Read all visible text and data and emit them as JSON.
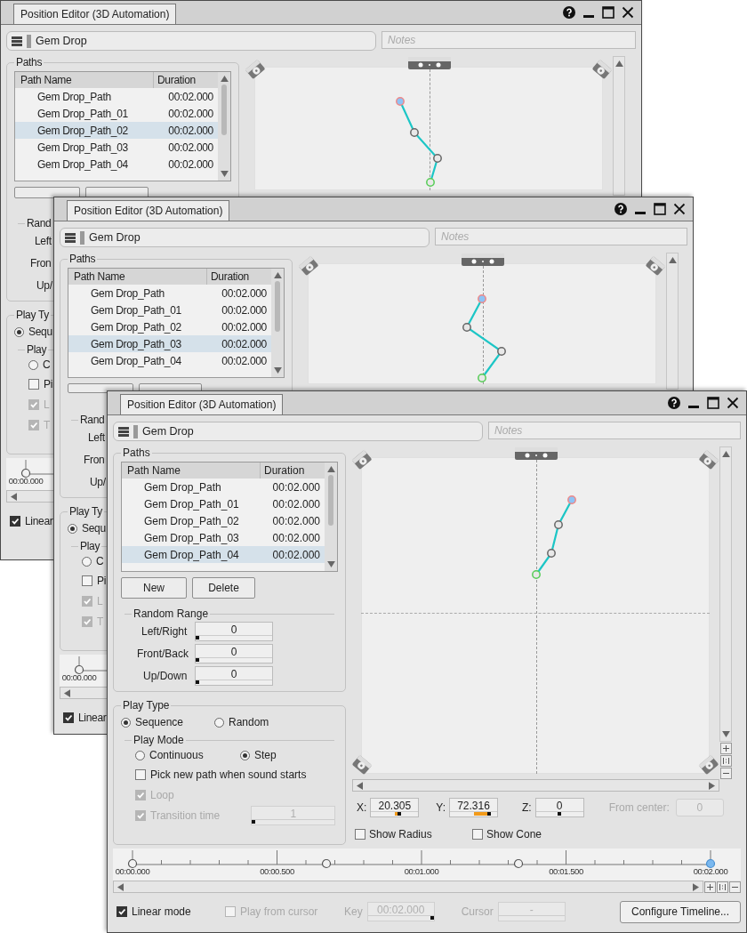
{
  "windows": [
    {
      "title": "Position Editor (3D Automation)",
      "name": "Gem Drop",
      "notes_placeholder": "Notes",
      "paths": {
        "label": "Paths",
        "columns": [
          "Path Name",
          "Duration"
        ],
        "rows": [
          {
            "name": "Gem Drop_Path",
            "duration": "00:02.000",
            "selected": false
          },
          {
            "name": "Gem Drop_Path_01",
            "duration": "00:02.000",
            "selected": false
          },
          {
            "name": "Gem Drop_Path_02",
            "duration": "00:02.000",
            "selected": true
          },
          {
            "name": "Gem Drop_Path_03",
            "duration": "00:02.000",
            "selected": false
          },
          {
            "name": "Gem Drop_Path_04",
            "duration": "00:02.000",
            "selected": false
          }
        ]
      },
      "random_range": {
        "label": "Rand",
        "rows": [
          {
            "label": "Left"
          },
          {
            "label": "Fron"
          },
          {
            "label": "Up/"
          }
        ]
      },
      "play_type": {
        "label": "Play Ty",
        "options": [
          {
            "label": "Sequ",
            "selected": true
          }
        ],
        "play_mode": {
          "label": "Play",
          "options": [
            {
              "label": "C",
              "selected": false
            }
          ],
          "settings": [
            {
              "label": "Pi",
              "checked": false,
              "disabled": false
            },
            {
              "label": "L",
              "checked": true,
              "disabled": true
            },
            {
              "label": "T",
              "checked": true,
              "disabled": true
            }
          ]
        }
      },
      "timeline": {
        "labels": [
          "00:00.000"
        ],
        "keys": [
          {
            "selected": false
          }
        ]
      },
      "bottom": {
        "linear_mode": {
          "label": "Linear",
          "checked": true,
          "disabled": false
        }
      }
    },
    {
      "title": "Position Editor (3D Automation)",
      "name": "Gem Drop",
      "notes_placeholder": "Notes",
      "paths": {
        "label": "Paths",
        "columns": [
          "Path Name",
          "Duration"
        ],
        "rows": [
          {
            "name": "Gem Drop_Path",
            "duration": "00:02.000",
            "selected": false
          },
          {
            "name": "Gem Drop_Path_01",
            "duration": "00:02.000",
            "selected": false
          },
          {
            "name": "Gem Drop_Path_02",
            "duration": "00:02.000",
            "selected": false
          },
          {
            "name": "Gem Drop_Path_03",
            "duration": "00:02.000",
            "selected": true
          },
          {
            "name": "Gem Drop_Path_04",
            "duration": "00:02.000",
            "selected": false
          }
        ]
      },
      "random_range": {
        "label": "Rand",
        "rows": [
          {
            "label": "Left"
          },
          {
            "label": "Fron"
          },
          {
            "label": "Up/"
          }
        ]
      },
      "play_type": {
        "label": "Play Ty",
        "options": [
          {
            "label": "Sequ",
            "selected": true
          }
        ],
        "play_mode": {
          "label": "Play",
          "options": [
            {
              "label": "C",
              "selected": false
            }
          ],
          "settings": [
            {
              "label": "Pi",
              "checked": false,
              "disabled": false
            },
            {
              "label": "L",
              "checked": true,
              "disabled": true
            },
            {
              "label": "T",
              "checked": true,
              "disabled": true
            }
          ]
        }
      },
      "timeline": {
        "labels": [
          "00:00.000"
        ],
        "keys": [
          {
            "selected": false
          }
        ]
      },
      "bottom": {
        "linear_mode": {
          "label": "Linear",
          "checked": true,
          "disabled": false
        }
      }
    },
    {
      "title": "Position Editor (3D Automation)",
      "name": "Gem Drop",
      "notes_placeholder": "Notes",
      "paths": {
        "label": "Paths",
        "columns": [
          "Path Name",
          "Duration"
        ],
        "rows": [
          {
            "name": "Gem Drop_Path",
            "duration": "00:02.000",
            "selected": false
          },
          {
            "name": "Gem Drop_Path_01",
            "duration": "00:02.000",
            "selected": false
          },
          {
            "name": "Gem Drop_Path_02",
            "duration": "00:02.000",
            "selected": false
          },
          {
            "name": "Gem Drop_Path_03",
            "duration": "00:02.000",
            "selected": false
          },
          {
            "name": "Gem Drop_Path_04",
            "duration": "00:02.000",
            "selected": true
          }
        ],
        "buttons": [
          "New",
          "Delete"
        ]
      },
      "random_range": {
        "label": "Random Range",
        "rows": [
          {
            "label": "Left/Right",
            "value": "0",
            "level": 0
          },
          {
            "label": "Front/Back",
            "value": "0",
            "level": 0
          },
          {
            "label": "Up/Down",
            "value": "0",
            "level": 0
          }
        ]
      },
      "play_type": {
        "label": "Play Type",
        "options": [
          {
            "label": "Sequence",
            "selected": true
          },
          {
            "label": "Random",
            "selected": false
          }
        ],
        "play_mode": {
          "label": "Play Mode",
          "options": [
            {
              "label": "Continuous",
              "selected": false
            },
            {
              "label": "Step",
              "selected": true
            }
          ],
          "settings": [
            {
              "label": "Pick new path when sound starts",
              "checked": false,
              "disabled": false
            },
            {
              "label": "Loop",
              "checked": true,
              "disabled": true
            },
            {
              "label": "Transition time",
              "checked": true,
              "disabled": true,
              "value": "1",
              "level": 0
            }
          ]
        }
      },
      "coordinates": [
        {
          "label": "X:",
          "value": "20.305",
          "level": 0.6
        },
        {
          "label": "Y:",
          "value": "72.316",
          "level": 0.86
        },
        {
          "label": "Z:",
          "value": "0",
          "level": 0.5
        }
      ],
      "from_center": {
        "label": "From center:",
        "value": "0",
        "disabled": true
      },
      "view_options": [
        {
          "label": "Show Radius",
          "checked": false
        },
        {
          "label": "Show Cone",
          "checked": false
        }
      ],
      "timeline": {
        "labels": [
          "00:00.000",
          "00:00.500",
          "00:01.000",
          "00:01.500",
          "00:02.000"
        ],
        "keys": [
          {
            "selected": false
          },
          {
            "selected": false
          },
          {
            "selected": false
          },
          {
            "selected": true
          }
        ]
      },
      "bottom": {
        "linear_mode": {
          "label": "Linear mode",
          "checked": true,
          "disabled": false
        },
        "play_from_cursor": {
          "label": "Play from cursor",
          "checked": false,
          "disabled": true
        },
        "key": {
          "label": "Key",
          "value": "00:02.000",
          "disabled": true,
          "level": 1
        },
        "cursor": {
          "label": "Cursor",
          "value": "-",
          "disabled": true
        },
        "configure_button": "Configure Timeline..."
      }
    }
  ]
}
